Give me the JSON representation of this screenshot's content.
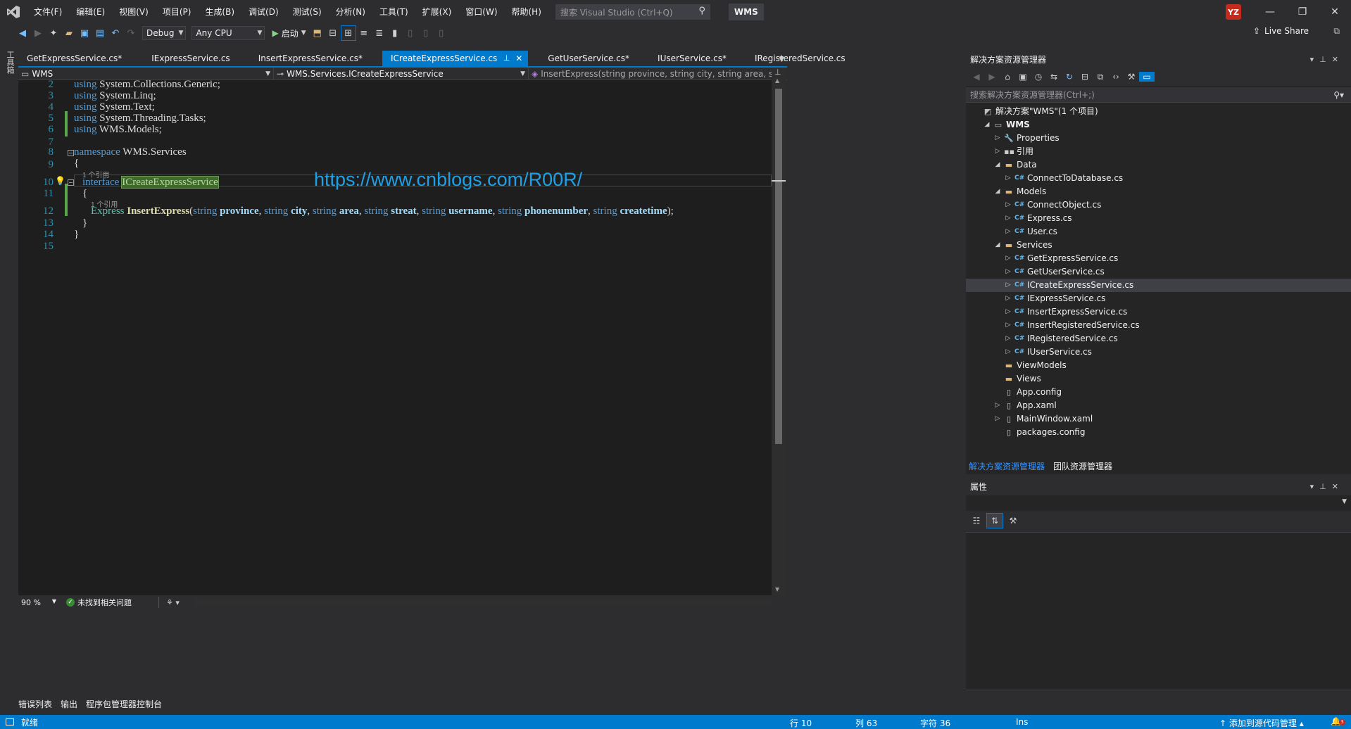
{
  "titlebar": {
    "menu": [
      "文件(F)",
      "编辑(E)",
      "视图(V)",
      "项目(P)",
      "生成(B)",
      "调试(D)",
      "测试(S)",
      "分析(N)",
      "工具(T)",
      "扩展(X)",
      "窗口(W)",
      "帮助(H)"
    ],
    "search_placeholder": "搜索 Visual Studio (Ctrl+Q)",
    "solution_name": "WMS",
    "user_initials": "YZ"
  },
  "toolbar": {
    "config": "Debug",
    "platform": "Any CPU",
    "start_label": "启动",
    "live_share": "Live Share"
  },
  "left_strip": {
    "tab": "工具箱"
  },
  "editor": {
    "tabs": [
      {
        "label": "GetExpressService.cs*",
        "active": false
      },
      {
        "label": "IExpressService.cs",
        "active": false
      },
      {
        "label": "InsertExpressService.cs*",
        "active": false
      },
      {
        "label": "ICreateExpressService.cs",
        "active": true
      },
      {
        "label": "GetUserService.cs*",
        "active": false
      },
      {
        "label": "IUserService.cs*",
        "active": false
      },
      {
        "label": "IRegisteredService.cs",
        "active": false
      }
    ],
    "nav_project": "WMS",
    "nav_type": "WMS.Services.ICreateExpressService",
    "nav_member": "InsertExpress(string province, string city, string area, string streat, stri",
    "lines": {
      "l2": {
        "num": "2",
        "kw": "using",
        "rest": " System.Collections.Generic;"
      },
      "l3": {
        "num": "3",
        "kw": "using",
        "rest": " System.Linq;"
      },
      "l4": {
        "num": "4",
        "kw": "using",
        "rest": " System.Text;"
      },
      "l5": {
        "num": "5",
        "kw": "using",
        "rest": " System.Threading.Tasks;"
      },
      "l6": {
        "num": "6",
        "kw": "using",
        "rest": " WMS.Models;"
      },
      "l7": {
        "num": "7"
      },
      "l8": {
        "num": "8",
        "kw": "namespace",
        "rest": " WMS.Services"
      },
      "l9": {
        "num": "9",
        "text": "{"
      },
      "ref1": "1 个引用",
      "l10": {
        "num": "10",
        "kw": "interface",
        "name": "ICreateExpressService"
      },
      "l11": {
        "num": "11",
        "text": "{"
      },
      "ref2": "1 个引用",
      "l12": {
        "num": "12",
        "type": "Express",
        "method": "InsertExpress",
        "params": [
          {
            "type": "string",
            "name": "province"
          },
          {
            "type": "string",
            "name": "city"
          },
          {
            "type": "string",
            "name": "area"
          },
          {
            "type": "string",
            "name": "streat"
          },
          {
            "type": "string",
            "name": "username"
          },
          {
            "type": "string",
            "name": "phonenumber"
          },
          {
            "type": "string",
            "name": "createtime"
          }
        ]
      },
      "l13": {
        "num": "13",
        "text": "}"
      },
      "l14": {
        "num": "14",
        "text": "}"
      },
      "l15": {
        "num": "15"
      }
    },
    "watermark": "https://www.cnblogs.com/R00R/",
    "zoom": "90 %",
    "issues": "未找到相关问题"
  },
  "bottom_tabs": [
    "错误列表",
    "输出",
    "程序包管理器控制台"
  ],
  "statusbar": {
    "ready": "就绪",
    "row": "行 10",
    "col": "列 63",
    "char": "字符 36",
    "mode": "Ins",
    "source_control": "添加到源代码管理",
    "notifications": "3"
  },
  "solution_explorer": {
    "title": "解决方案资源管理器",
    "search_placeholder": "搜索解决方案资源管理器(Ctrl+;)",
    "tree": [
      {
        "label": "解决方案\"WMS\"(1 个项目)",
        "depth": 0,
        "icon": "solution",
        "exp": ""
      },
      {
        "label": "WMS",
        "depth": 1,
        "icon": "project",
        "exp": "open",
        "bold": true
      },
      {
        "label": "Properties",
        "depth": 2,
        "icon": "wrench",
        "exp": "closed"
      },
      {
        "label": "引用",
        "depth": 2,
        "icon": "refs",
        "exp": "closed"
      },
      {
        "label": "Data",
        "depth": 2,
        "icon": "folder",
        "exp": "open"
      },
      {
        "label": "ConnectToDatabase.cs",
        "depth": 3,
        "icon": "cs",
        "exp": "closed"
      },
      {
        "label": "Models",
        "depth": 2,
        "icon": "folder",
        "exp": "open"
      },
      {
        "label": "ConnectObject.cs",
        "depth": 3,
        "icon": "cs",
        "exp": "closed"
      },
      {
        "label": "Express.cs",
        "depth": 3,
        "icon": "cs",
        "exp": "closed"
      },
      {
        "label": "User.cs",
        "depth": 3,
        "icon": "cs",
        "exp": "closed"
      },
      {
        "label": "Services",
        "depth": 2,
        "icon": "folder",
        "exp": "open"
      },
      {
        "label": "GetExpressService.cs",
        "depth": 3,
        "icon": "cs",
        "exp": "closed"
      },
      {
        "label": "GetUserService.cs",
        "depth": 3,
        "icon": "cs",
        "exp": "closed"
      },
      {
        "label": "ICreateExpressService.cs",
        "depth": 3,
        "icon": "cs",
        "exp": "closed",
        "selected": true
      },
      {
        "label": "IExpressService.cs",
        "depth": 3,
        "icon": "cs",
        "exp": "closed"
      },
      {
        "label": "InsertExpressService.cs",
        "depth": 3,
        "icon": "cs",
        "exp": "closed"
      },
      {
        "label": "InsertRegisteredService.cs",
        "depth": 3,
        "icon": "cs",
        "exp": "closed"
      },
      {
        "label": "IRegisteredService.cs",
        "depth": 3,
        "icon": "cs",
        "exp": "closed"
      },
      {
        "label": "IUserService.cs",
        "depth": 3,
        "icon": "cs",
        "exp": "closed"
      },
      {
        "label": "ViewModels",
        "depth": 2,
        "icon": "folder",
        "exp": ""
      },
      {
        "label": "Views",
        "depth": 2,
        "icon": "folder",
        "exp": ""
      },
      {
        "label": "App.config",
        "depth": 2,
        "icon": "file",
        "exp": ""
      },
      {
        "label": "App.xaml",
        "depth": 2,
        "icon": "file",
        "exp": "closed"
      },
      {
        "label": "MainWindow.xaml",
        "depth": 2,
        "icon": "file",
        "exp": "closed"
      },
      {
        "label": "packages.config",
        "depth": 2,
        "icon": "file",
        "exp": ""
      }
    ],
    "tabs": [
      "解决方案资源管理器",
      "团队资源管理器"
    ]
  },
  "properties": {
    "title": "属性"
  },
  "colors": {
    "accent": "#007acc",
    "keyword": "#569cd6",
    "type": "#4ec9b0",
    "param": "#9cdcfe",
    "watermark": "#1ea0e6"
  }
}
